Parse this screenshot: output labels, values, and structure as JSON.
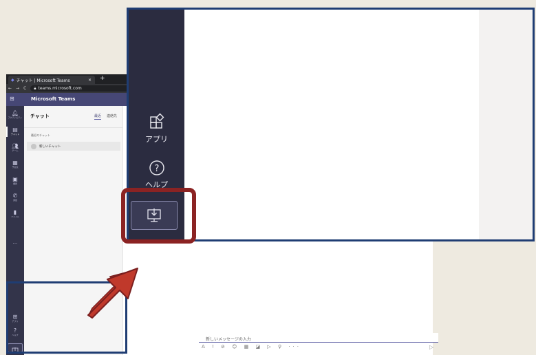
{
  "browser": {
    "tab_title": "チャット | Microsoft Teams",
    "tab_close": "×",
    "tab_new": "+",
    "nav_back": "←",
    "nav_forward": "→",
    "nav_reload": "C",
    "url": "teams.microsoft.com"
  },
  "teams": {
    "app_title": "Microsoft Teams",
    "waffle_icon": "app-launcher-icon",
    "rail": [
      {
        "label": "アクティビティ",
        "icon": "bell-icon"
      },
      {
        "label": "チャット",
        "icon": "chat-icon",
        "active": true
      },
      {
        "label": "チーム",
        "icon": "teams-icon"
      },
      {
        "label": "予定表",
        "icon": "calendar-icon"
      },
      {
        "label": "課題",
        "icon": "assignments-icon"
      },
      {
        "label": "通話",
        "icon": "phone-icon"
      },
      {
        "label": "ファイル",
        "icon": "files-icon"
      }
    ],
    "rail_more": "···",
    "list": {
      "heading": "チャット",
      "tab_recent": "最近",
      "tab_contacts": "連絡先",
      "recent_section": "最近のチャット",
      "new_chat_item": "新しいチャット"
    },
    "compose": {
      "placeholder": "新しいメッセージの入力",
      "tools": "A ! ⊘ ☺ ▦ ◪ ▷ ♀ ···",
      "send": "▷"
    }
  },
  "zoom": {
    "apps_label": "アプリ",
    "help_label": "ヘルプ",
    "help_glyph": "?",
    "download_icon": "download-desktop-icon"
  },
  "small_bottom": {
    "apps_label": "アプリ",
    "help_label": "ヘルプ"
  },
  "colors": {
    "rail": "#2b2c40",
    "header": "#464775",
    "highlight_red": "#8b2323",
    "callout_blue": "#1f3d73",
    "arrow_red": "#c0392b"
  }
}
